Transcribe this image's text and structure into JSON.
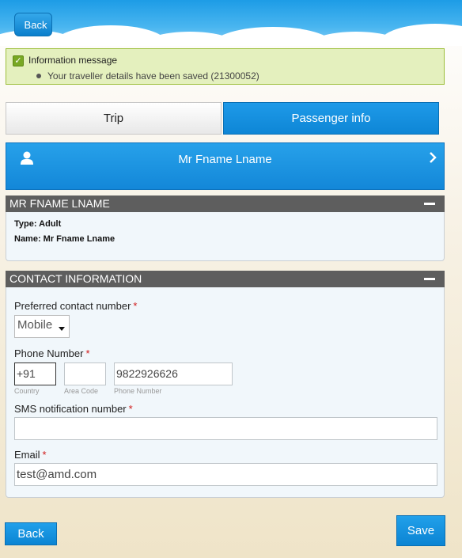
{
  "header": {
    "back_label": "Back"
  },
  "info": {
    "title": "Information message",
    "items": [
      "Your traveller details have been saved (21300052)"
    ]
  },
  "tabs": [
    {
      "label": "Trip",
      "active": false
    },
    {
      "label": "Passenger info",
      "active": true
    }
  ],
  "passenger_banner": {
    "name": "Mr Fname Lname"
  },
  "passenger_section": {
    "title": "MR FNAME LNAME",
    "type_line": "Type: Adult",
    "name_line": "Name: Mr Fname Lname"
  },
  "contact_section": {
    "title": "CONTACT INFORMATION",
    "preferred_label": "Preferred contact number",
    "preferred_value": "Mobile",
    "phone_label": "Phone Number",
    "country_value": "+91",
    "area_value": "",
    "phone_value": "9822926626",
    "country_caption": "Country",
    "area_caption": "Area Code",
    "phone_caption": "Phone Number",
    "sms_label": "SMS notification number",
    "sms_value": "",
    "email_label": "Email",
    "email_value": "test@amd.com",
    "required_mark": "*"
  },
  "footer": {
    "back_label": "Back",
    "save_label": "Save"
  },
  "colors": {
    "accent": "#0e86d6",
    "info_bg": "#e4f0be",
    "section_head": "#5e5e5e",
    "required": "#d01818"
  }
}
